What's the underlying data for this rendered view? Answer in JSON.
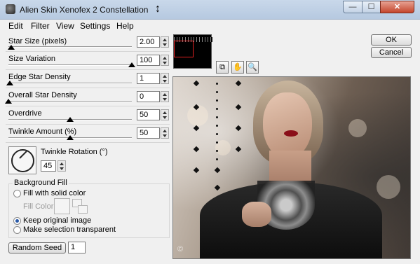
{
  "window": {
    "title": "Alien Skin Xenofex 2 Constellation",
    "minimize_glyph": "—",
    "maximize_glyph": "☐",
    "close_glyph": "✕"
  },
  "menu": [
    "Edit",
    "Filter",
    "View",
    "Settings",
    "Help"
  ],
  "params": [
    {
      "label": "Star Size (pixels)",
      "value": "2.00",
      "level": 0.02
    },
    {
      "label": "Size Variation",
      "value": "100",
      "level": 1.0
    },
    {
      "label": "Edge Star Density",
      "value": "1",
      "level": 0.01
    },
    {
      "label": "Overall Star Density",
      "value": "0",
      "level": 0.0
    },
    {
      "label": "Overdrive",
      "value": "50",
      "level": 0.5
    },
    {
      "label": "Twinkle Amount (%)",
      "value": "50",
      "level": 0.5
    }
  ],
  "twinkle_rotation": {
    "label": "Twinkle Rotation (°)",
    "value": "45"
  },
  "background_fill": {
    "title": "Background Fill",
    "options": [
      {
        "label": "Fill with solid color",
        "checked": false
      },
      {
        "label": "Keep original image",
        "checked": true
      },
      {
        "label": "Make selection transparent",
        "checked": false
      }
    ],
    "fill_color_label": "Fill Color"
  },
  "random_seed": {
    "label": "Random Seed",
    "value": "1"
  },
  "buttons": {
    "ok": "OK",
    "cancel": "Cancel"
  },
  "tools": {
    "icons": [
      "navigator-tool-icon",
      "hand-tool-icon",
      "zoom-tool-icon"
    ],
    "glyphs": [
      "⧉",
      "✋",
      "🔍"
    ]
  },
  "preview": {
    "watermark": "©"
  }
}
